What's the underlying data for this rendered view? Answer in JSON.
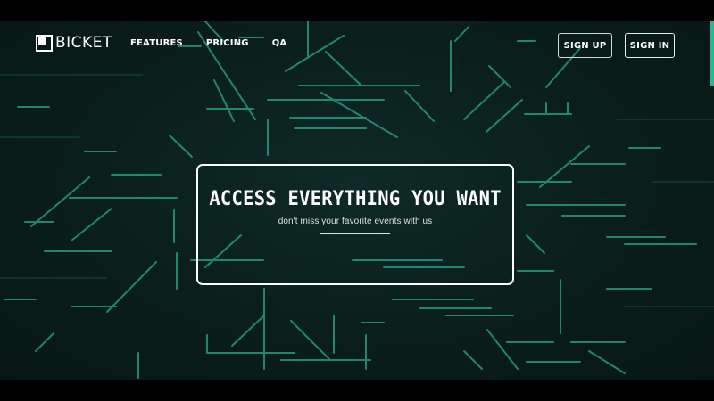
{
  "brand": {
    "name": "BICKET"
  },
  "nav": {
    "links": [
      "FEATURES",
      "PRICING",
      "QA"
    ],
    "signup_label": "SIGN UP",
    "signin_label": "SIGN IN"
  },
  "hero": {
    "title": "ACCESS EVERYTHING YOU WANT",
    "subtitle": "don't miss your favorite events with us"
  },
  "colors": {
    "background": "#0a1e1b",
    "accent": "#2bb596",
    "text": "#ffffff"
  }
}
